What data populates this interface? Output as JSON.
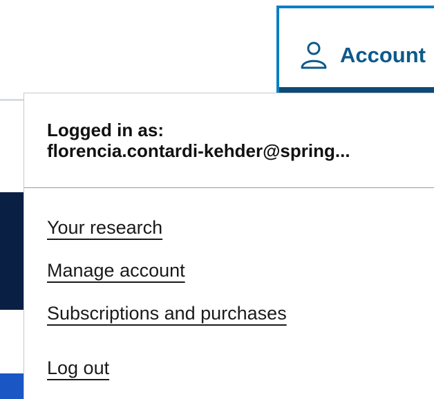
{
  "account_button": {
    "label": "Account",
    "icon": "user-icon",
    "border_color": "#0b7fc5",
    "text_color": "#0d5a8a"
  },
  "dropdown": {
    "logged_in_label": "Logged in as:",
    "logged_in_email": "florencia.contardi-kehder@spring...",
    "menu_items": [
      {
        "label": "Your research"
      },
      {
        "label": "Manage account"
      },
      {
        "label": "Subscriptions and purchases"
      },
      {
        "label": "Log out"
      }
    ]
  }
}
